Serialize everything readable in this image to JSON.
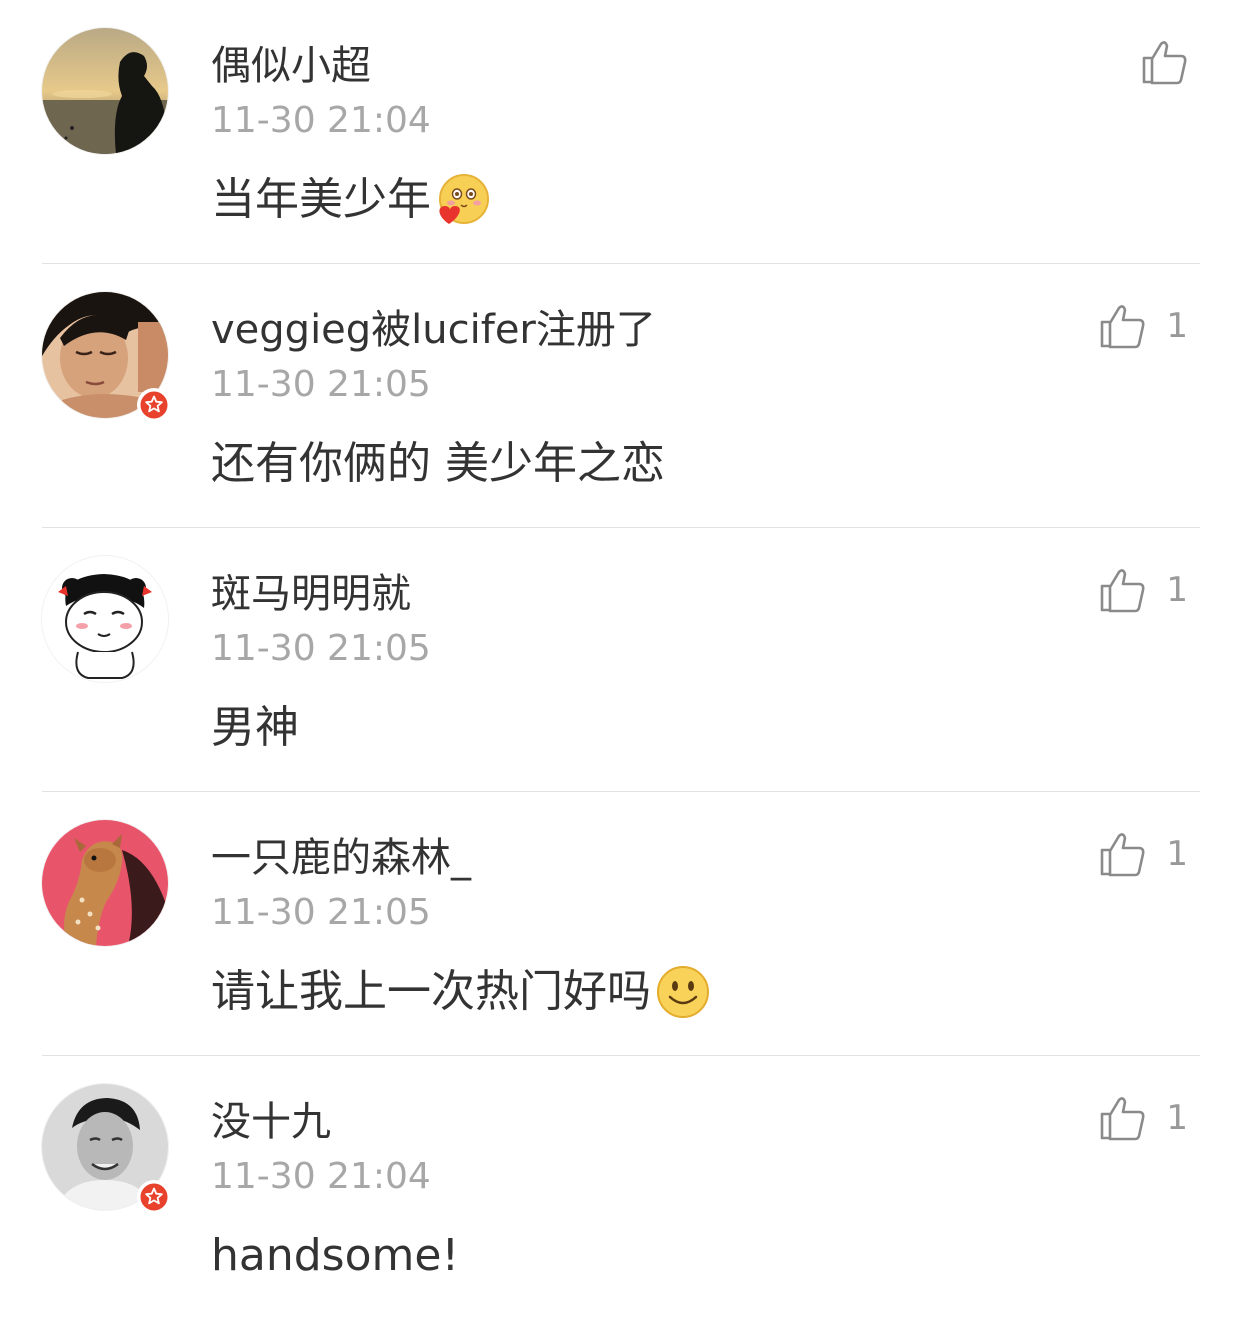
{
  "comments": [
    {
      "username": "偶似小超",
      "time": "11-30 21:04",
      "text": "当年美少年",
      "likes": "",
      "verified": false,
      "emoji": "heart-kiss-emoji"
    },
    {
      "username": "veggieg被lucifer注册了",
      "time": "11-30 21:05",
      "text": "还有你俩的 美少年之恋",
      "likes": "1",
      "verified": true,
      "emoji": ""
    },
    {
      "username": "斑马明明就",
      "time": "11-30 21:05",
      "text": "男神",
      "likes": "1",
      "verified": false,
      "emoji": ""
    },
    {
      "username": "一只鹿的森林_",
      "time": "11-30 21:05",
      "text": "请让我上一次热门好吗",
      "likes": "1",
      "verified": false,
      "emoji": "smile-emoji"
    },
    {
      "username": "没十九",
      "time": "11-30 21:04",
      "text": "handsome!",
      "likes": "1",
      "verified": true,
      "emoji": ""
    }
  ],
  "colors": {
    "text": "#333333",
    "meta": "#a7a7a7",
    "verified_badge": "#e8412c",
    "divider": "#e2e2e2"
  },
  "icons": {
    "like": "thumbs-up-icon",
    "verified": "verified-star-badge"
  }
}
